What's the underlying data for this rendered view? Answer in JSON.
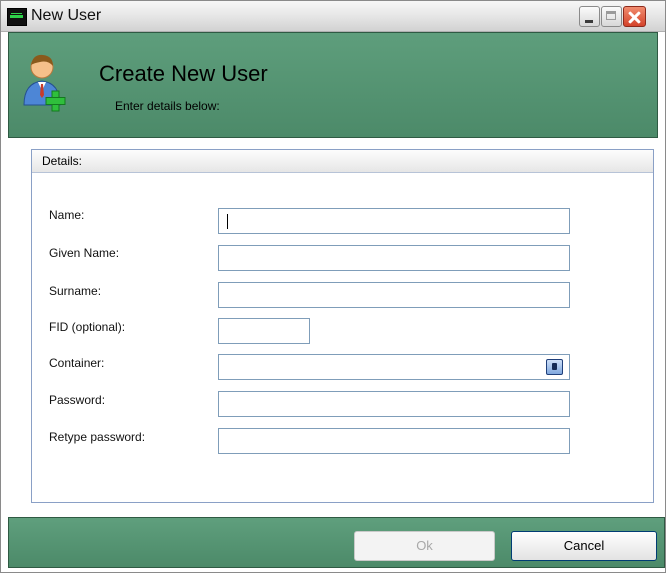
{
  "window": {
    "title": "New User",
    "controls": [
      "minimize-icon",
      "maximize-icon",
      "close-icon"
    ]
  },
  "header": {
    "title": "Create New User",
    "subtitle": "Enter details below:",
    "icon": "add-user-icon",
    "background_color": "#4f8d6c"
  },
  "details": {
    "group_label": "Details:",
    "fields": [
      {
        "label": "Name:",
        "value": "",
        "focused": true
      },
      {
        "label": "Given Name:",
        "value": ""
      },
      {
        "label": "Surname:",
        "value": ""
      },
      {
        "label": "FID (optional):",
        "value": ""
      },
      {
        "label": "Container:",
        "value": "",
        "button_icon": "browse-icon"
      },
      {
        "label": "Password:",
        "value": ""
      },
      {
        "label": "Retype password:",
        "value": ""
      }
    ]
  },
  "footer": {
    "ok_label": "Ok",
    "ok_enabled": false,
    "cancel_label": "Cancel"
  }
}
